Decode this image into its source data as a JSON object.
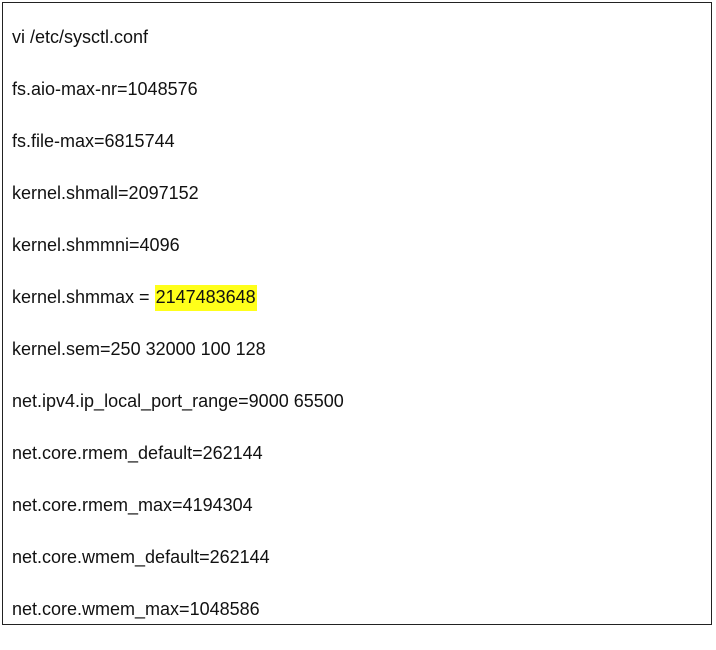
{
  "document": {
    "lines": [
      {
        "text": "vi /etc/sysctl.conf"
      },
      {
        "text": "fs.aio-max-nr=1048576"
      },
      {
        "text": "fs.file-max=6815744"
      },
      {
        "text": "kernel.shmall=2097152"
      },
      {
        "text": "kernel.shmmni=4096"
      },
      {
        "prefix": "kernel.shmmax = ",
        "highlight": "2147483648"
      },
      {
        "text": "kernel.sem=250 32000 100 128"
      },
      {
        "text": "net.ipv4.ip_local_port_range=9000 65500"
      },
      {
        "text": "net.core.rmem_default=262144"
      },
      {
        "text": "net.core.rmem_max=4194304"
      },
      {
        "text": "net.core.wmem_default=262144"
      },
      {
        "text": "net.core.wmem_max=1048586"
      }
    ]
  },
  "colors": {
    "highlight": "#ffff1a",
    "text": "#111111",
    "border": "#222222"
  }
}
